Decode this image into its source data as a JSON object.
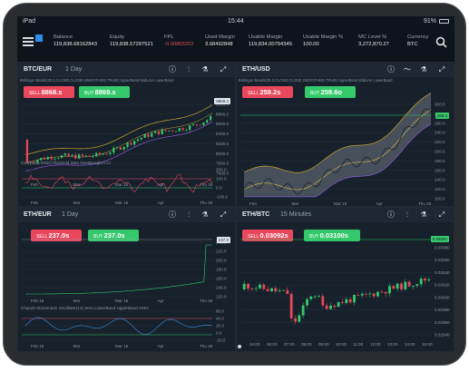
{
  "status": {
    "carrier": "iPad",
    "time": "15:44",
    "battery": "91%"
  },
  "account": [
    {
      "label": "Balance",
      "value": "119,838.68162843",
      "neg": false
    },
    {
      "label": "Equity",
      "value": "119,838.57297521",
      "neg": false
    },
    {
      "label": "FPL",
      "value": "-0.00865322",
      "neg": true
    },
    {
      "label": "Used Margin",
      "value": "3.68492848",
      "neg": false
    },
    {
      "label": "Usable Margin",
      "value": "119,834.00794345",
      "neg": false
    },
    {
      "label": "Usable Margin %",
      "value": "100.00",
      "neg": false
    },
    {
      "label": "MC Level %",
      "value": "3,272,870.27",
      "neg": false
    },
    {
      "label": "Currency",
      "value": "BTC",
      "neg": false
    }
  ],
  "panels": [
    {
      "pair": "BTC/EUR",
      "period": "1 Day",
      "indicators": "Bollinger Bands(20,2,CLOSE,CLOSE,SMOOTHED,TRUE) UpperBand MidLine LowerBand",
      "sell_label": "SELL",
      "sell_price": "8868.s",
      "buy_label": "BUY",
      "buy_price": "8869.s",
      "price_tag": "8869.4",
      "yticks": [
        "9000.0",
        "8800.0",
        "8600.0",
        "8400.0",
        "8200.0",
        "8000.0",
        "7800.0",
        "7600.0"
      ],
      "xticks": [
        "Feb",
        "Mar",
        "Mar 15",
        "Apr",
        "Thu 26"
      ],
      "osc_label": "CCI(14,CLOSE) OverSold Zero OverBought CCI",
      "osc_ticks": [
        "200.0",
        "100.0",
        "0.0",
        "-100.0"
      ],
      "osc_xticks": [
        "Feb",
        "Mar",
        "Mar 15",
        "Apr",
        "Thu 26"
      ]
    },
    {
      "pair": "ETH/USD",
      "period": "1 Day",
      "indicators": "Bollinger Bands(20,2,CLOSE,CLOSE,SMOOTHED,TRUE) UpperBand MidLine LowerBand",
      "sell_label": "SELL",
      "sell_price": "259.2s",
      "buy_label": "BUY",
      "buy_price": "259.6o",
      "price_tag": "259.4",
      "yticks": [
        "300.0",
        "280.0",
        "260.0",
        "240.0",
        "220.0",
        "200.0",
        "180.0",
        "160.0",
        "140.0",
        "120.0",
        "100.0"
      ],
      "xticks": [
        "Feb",
        "Mar",
        "Mar 15",
        "Apr",
        "Thu 26"
      ]
    },
    {
      "pair": "ETH/EUR",
      "period": "1 Day",
      "sell_label": "SELL",
      "sell_price": "237.0s",
      "buy_label": "BUY",
      "buy_price": "237.0s",
      "price_tag": "237.0",
      "yticks": [
        "240.0",
        "220.0",
        "200.0",
        "180.0",
        "160.0",
        "140.0",
        "120.0"
      ],
      "xticks": [
        "Feb 15",
        "Mar",
        "Mar 15",
        "Apr",
        "Thu 26"
      ],
      "osc_label": "Chande Momentum Oscillator(14) Zero LowerBand UpperBand CMO",
      "osc_ticks": [
        "60.0",
        "40.0",
        "20.0",
        "0.0",
        "-20.0"
      ],
      "osc_xticks": [
        "Feb 15",
        "Mar",
        "Mar 15",
        "Apr",
        "Thu 26"
      ]
    },
    {
      "pair": "ETH/BTC",
      "period": "15 Minutes",
      "sell_label": "SELL",
      "sell_price": "0.03092s",
      "buy_label": "BUY",
      "buy_price": "0.03100s",
      "price_tag": "0.03094",
      "yticks": [
        "0.03080",
        "0.03060",
        "0.03040",
        "0.03020",
        "0.03000",
        "0.02980",
        "0.02960",
        "0.02940"
      ],
      "xticks": [
        "04:00",
        "06:00",
        "07:00",
        "08:00",
        "09:00",
        "10:00",
        "11:00",
        "12:00",
        "13:00",
        "14:00",
        "15:00"
      ]
    }
  ]
}
